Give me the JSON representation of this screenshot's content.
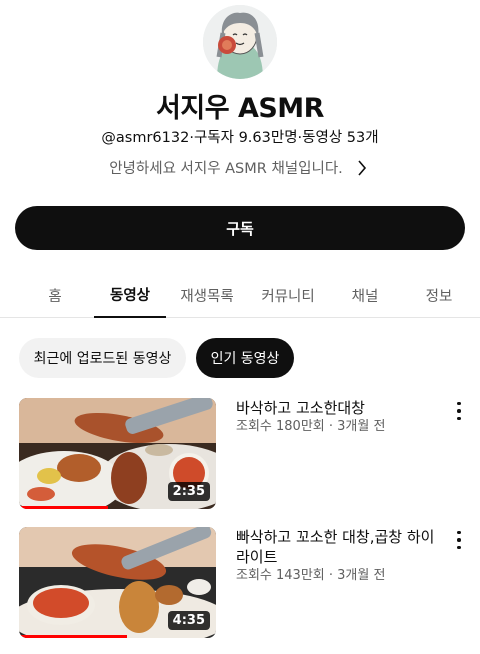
{
  "channel": {
    "name": "서지우 ASMR",
    "meta": "@asmr6132·구독자 9.63만명·동영상 53개",
    "description": "안녕하세요 서지우 ASMR 채널입니다.",
    "subscribe_label": "구독"
  },
  "tabs": [
    {
      "label": "홈",
      "active": false
    },
    {
      "label": "동영상",
      "active": true
    },
    {
      "label": "재생목록",
      "active": false
    },
    {
      "label": "커뮤니티",
      "active": false
    },
    {
      "label": "채널",
      "active": false
    },
    {
      "label": "정보",
      "active": false
    }
  ],
  "filters": [
    {
      "label": "최근에 업로드된 동영상",
      "active": false
    },
    {
      "label": "인기 동영상",
      "active": true
    }
  ],
  "videos": [
    {
      "title": "바삭하고 고소한대창",
      "stats": "조회수 180만회 · 3개월 전",
      "duration": "2:35",
      "watched": 0.45
    },
    {
      "title": "빠삭하고 꼬소한 대창,곱창 하이라이트",
      "stats": "조회수 143만회 · 3개월 전",
      "duration": "4:35",
      "watched": 0.55
    }
  ],
  "colors": {
    "accent": "#0f0f0f",
    "progress": "#ff0000",
    "secondary_text": "#606060"
  }
}
